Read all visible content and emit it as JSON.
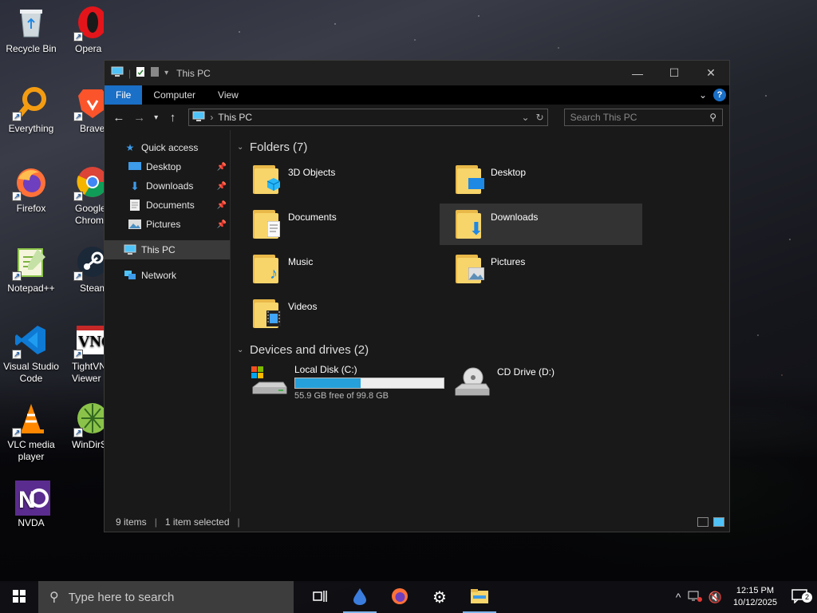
{
  "desktop": {
    "icons": [
      {
        "label": "Recycle Bin"
      },
      {
        "label": "Opera Browser"
      },
      {
        "label": "Everything"
      },
      {
        "label": "Brave"
      },
      {
        "label": "Firefox"
      },
      {
        "label": "Google Chrome"
      },
      {
        "label": "Notepad++"
      },
      {
        "label": "Steam"
      },
      {
        "label": "Visual Studio Code"
      },
      {
        "label": "TightVNC Viewer"
      },
      {
        "label": "VLC media player"
      },
      {
        "label": "WinDirStat"
      },
      {
        "label": "NVDA"
      }
    ]
  },
  "window": {
    "title": "This PC",
    "controls": {
      "minimize": "—",
      "maximize": "☐",
      "close": "✕"
    },
    "ribbon": {
      "tabs": [
        "File",
        "Computer",
        "View"
      ],
      "help": "?"
    },
    "address": {
      "path": "This PC"
    },
    "search": {
      "placeholder": "Search This PC"
    },
    "nav": {
      "quick_access": "Quick access",
      "items": [
        {
          "label": "Desktop",
          "pinned": true
        },
        {
          "label": "Downloads",
          "pinned": true
        },
        {
          "label": "Documents",
          "pinned": true
        },
        {
          "label": "Pictures",
          "pinned": true
        }
      ],
      "this_pc": "This PC",
      "network": "Network"
    },
    "folders": {
      "heading": "Folders",
      "count": "(7)",
      "items": [
        {
          "name": "3D Objects",
          "icon": "cube-icon"
        },
        {
          "name": "Desktop",
          "icon": "desktop-icon"
        },
        {
          "name": "Documents",
          "icon": "document-icon"
        },
        {
          "name": "Downloads",
          "icon": "download-icon",
          "selected": true
        },
        {
          "name": "Music",
          "icon": "music-icon"
        },
        {
          "name": "Pictures",
          "icon": "picture-icon"
        },
        {
          "name": "Videos",
          "icon": "video-icon"
        }
      ]
    },
    "drives": {
      "heading": "Devices and drives",
      "count": "(2)",
      "items": [
        {
          "name": "Local Disk (C:)",
          "free_text": "55.9 GB free of 99.8 GB",
          "used_fraction": 0.44
        },
        {
          "name": "CD Drive (D:)"
        }
      ]
    },
    "status": {
      "items": "9 items",
      "selected": "1 item selected"
    }
  },
  "taskbar": {
    "search_placeholder": "Type here to search",
    "time": "12:15 PM",
    "date": "10/12/2025",
    "notifications": "2"
  },
  "colors": {
    "accent": "#1a6fc6",
    "progress": "#26a0da",
    "folder": "#f7d56b"
  }
}
